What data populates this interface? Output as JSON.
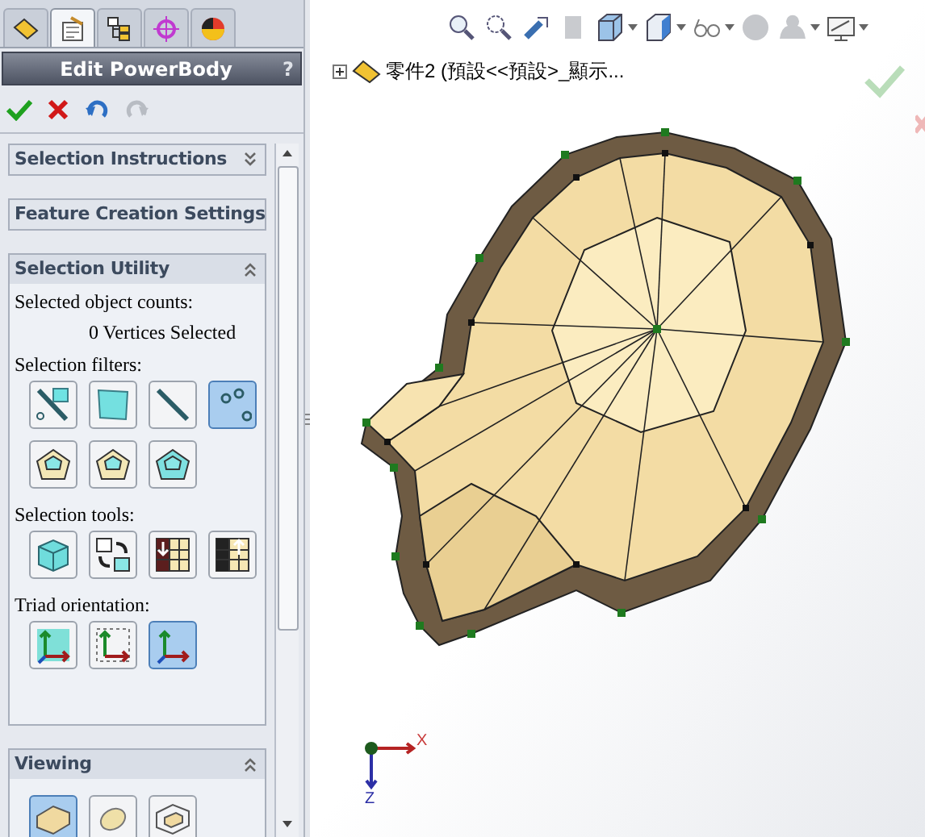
{
  "tabs": [
    {
      "kind": "feature",
      "selected": false
    },
    {
      "kind": "property",
      "selected": true
    },
    {
      "kind": "config",
      "selected": false
    },
    {
      "kind": "target",
      "selected": false
    },
    {
      "kind": "display",
      "selected": false
    }
  ],
  "panel": {
    "title": "Edit PowerBody",
    "help": "?"
  },
  "sections": [
    {
      "title": "Selection Instructions",
      "expanded": false
    },
    {
      "title": "Feature Creation Settings",
      "expanded": false
    },
    {
      "title": "Selection Utility",
      "expanded": true,
      "counts_label": "Selected object counts:",
      "count_text": "0 Vertices Selected",
      "groups": [
        {
          "label": "Selection filters:",
          "buttons": [
            {
              "kind": "vertex-edge",
              "selected": false
            },
            {
              "kind": "face",
              "selected": false
            },
            {
              "kind": "edge",
              "selected": false
            },
            {
              "kind": "vertex",
              "selected": true
            },
            {
              "kind": "ring-a",
              "selected": false
            },
            {
              "kind": "ring-b",
              "selected": false
            },
            {
              "kind": "ring-c",
              "selected": false
            }
          ]
        },
        {
          "label": "Selection tools:",
          "buttons": [
            {
              "kind": "cube",
              "selected": false
            },
            {
              "kind": "swap",
              "selected": false
            },
            {
              "kind": "grid-down",
              "selected": false
            },
            {
              "kind": "grid-up",
              "selected": false
            }
          ]
        },
        {
          "label": "Triad orientation:",
          "buttons": [
            {
              "kind": "triad-plane",
              "selected": false
            },
            {
              "kind": "triad-box",
              "selected": false
            },
            {
              "kind": "triad-3d",
              "selected": true
            }
          ]
        }
      ]
    },
    {
      "title": "Viewing",
      "expanded": true,
      "groups": [
        {
          "buttons": [
            {
              "kind": "shaded-block",
              "selected": true
            },
            {
              "kind": "ellipsoid",
              "selected": false
            },
            {
              "kind": "wire-block",
              "selected": false
            }
          ]
        }
      ]
    }
  ],
  "tree": {
    "label": "零件2 (預設<<預設>_顯示..."
  },
  "triad": {
    "x": "X",
    "z": "Z"
  }
}
